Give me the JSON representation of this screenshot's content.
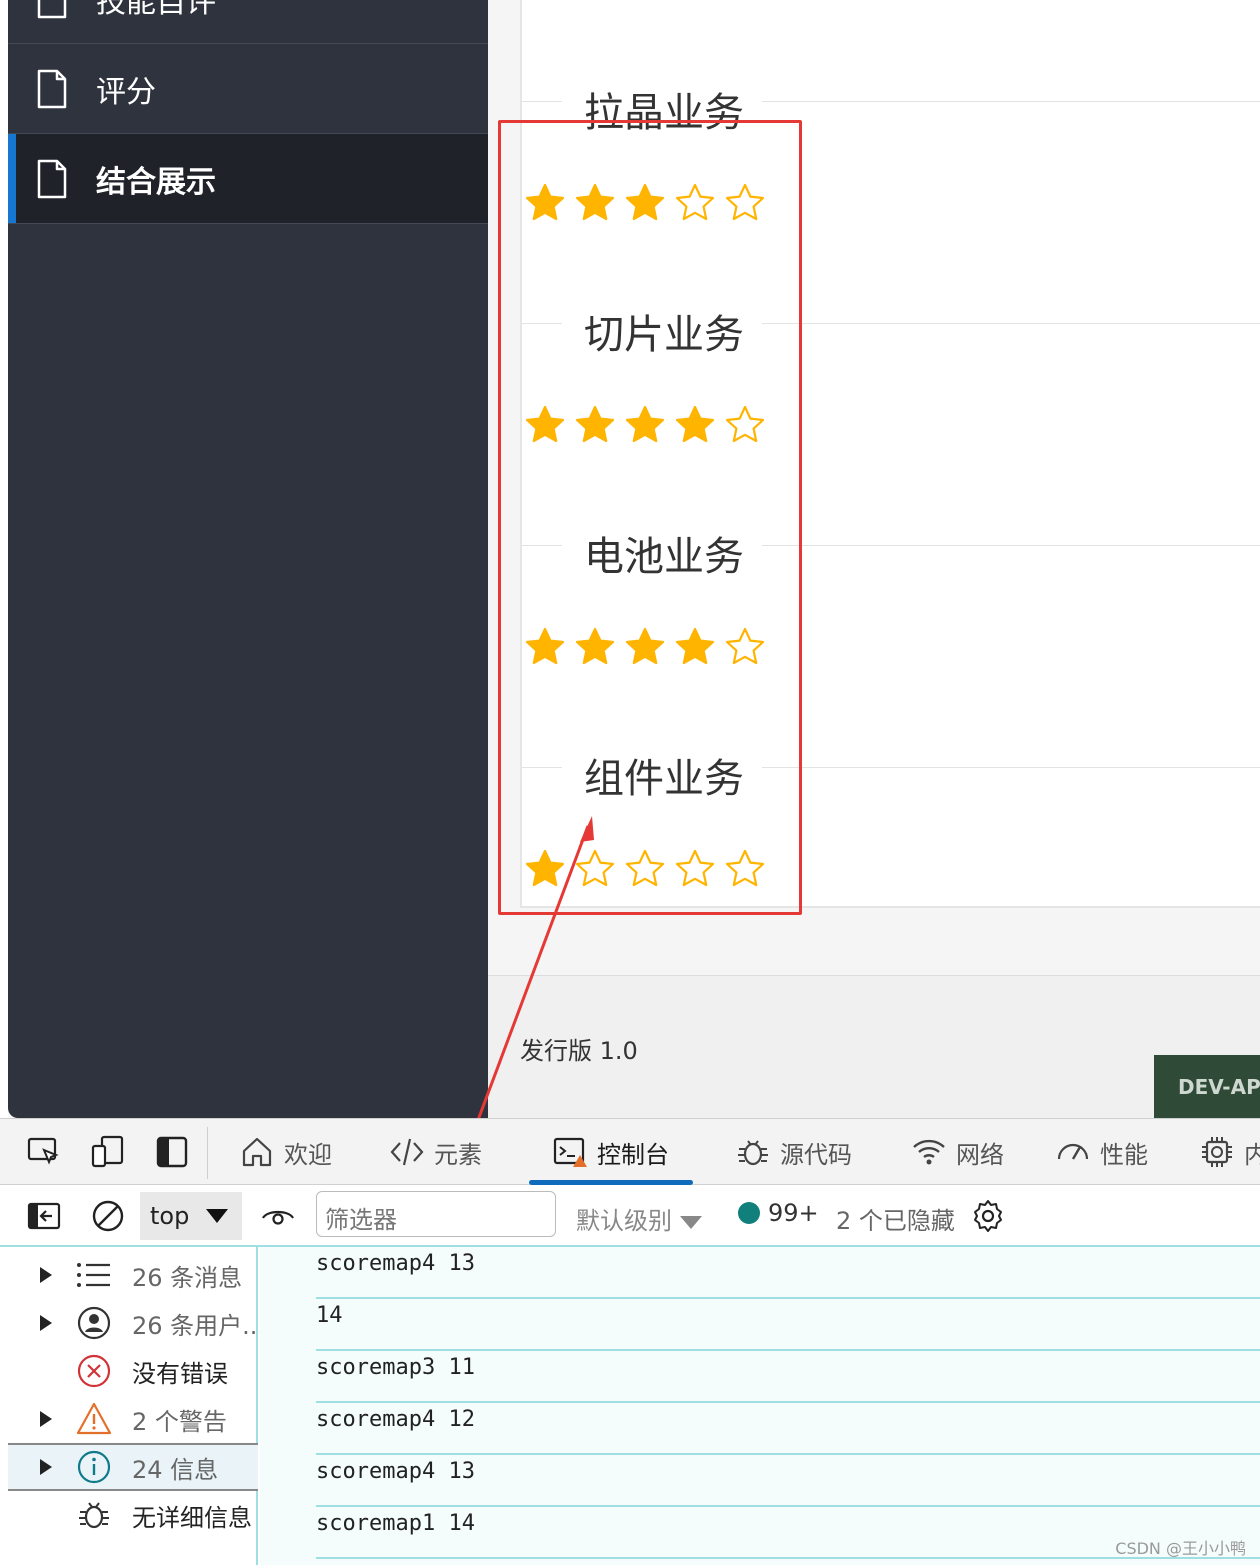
{
  "sidebar": {
    "items": [
      {
        "label": "技能自评"
      },
      {
        "label": "评分"
      },
      {
        "label": "结合展示"
      }
    ]
  },
  "rating": {
    "items": [
      {
        "title": "拉晶业务",
        "score": 3,
        "max": 5
      },
      {
        "title": "切片业务",
        "score": 4,
        "max": 5
      },
      {
        "title": "电池业务",
        "score": 4,
        "max": 5
      },
      {
        "title": "组件业务",
        "score": 1,
        "max": 5
      }
    ],
    "star_color": "#ffb400"
  },
  "footer": {
    "release": "发行版 1.0",
    "badge": "DEV-APE"
  },
  "devtools": {
    "tabs": [
      {
        "label": "欢迎",
        "icon": "home-icon"
      },
      {
        "label": "元素",
        "icon": "code-icon"
      },
      {
        "label": "控制台",
        "icon": "console-icon"
      },
      {
        "label": "源代码",
        "icon": "bug-icon"
      },
      {
        "label": "网络",
        "icon": "wifi-icon"
      },
      {
        "label": "性能",
        "icon": "gauge-icon"
      },
      {
        "label": "内",
        "icon": "chip-icon"
      }
    ],
    "active_tab": "控制台",
    "context": "top",
    "filter_placeholder": "筛选器",
    "level": "默认级别",
    "msg_count": "99+",
    "hidden": "2 个已隐藏",
    "sidebar": [
      {
        "label": "26 条消息",
        "icon": "list-icon"
      },
      {
        "label": "26 条用户...",
        "icon": "user-icon"
      },
      {
        "label": "没有错误",
        "icon": "error-icon"
      },
      {
        "label": "2 个警告",
        "icon": "warning-icon"
      },
      {
        "label": "24 信息",
        "icon": "info-icon"
      },
      {
        "label": "无详细信息",
        "icon": "bug-icon"
      }
    ],
    "logs": [
      "scoremap4 13",
      "14",
      "scoremap3 11",
      "scoremap4 12",
      "scoremap4 13",
      "scoremap1 14"
    ]
  },
  "watermark": "CSDN @王小小鸭"
}
